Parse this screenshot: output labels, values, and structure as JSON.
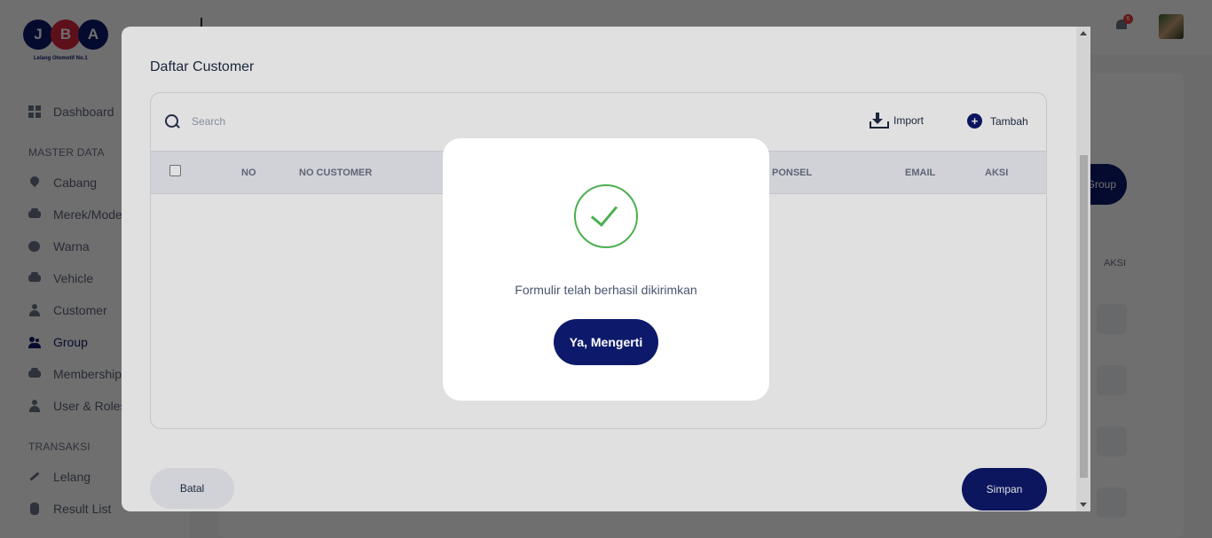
{
  "logo": {
    "letters": [
      "J",
      "B",
      "A"
    ],
    "tagline": "Lelang Otomotif No.1"
  },
  "sidebar": {
    "items": [
      {
        "label": "Dashboard",
        "icon": "grid-icon"
      },
      {
        "label": "Cabang",
        "icon": "location-pin-icon"
      },
      {
        "label": "Merek/Model",
        "icon": "car-icon"
      },
      {
        "label": "Warna",
        "icon": "palette-icon"
      },
      {
        "label": "Vehicle",
        "icon": "car-icon"
      },
      {
        "label": "Customer",
        "icon": "user-icon"
      },
      {
        "label": "Group",
        "icon": "group-icon"
      },
      {
        "label": "Membership",
        "icon": "car-icon"
      },
      {
        "label": "User & Roles",
        "icon": "user-roles-icon"
      },
      {
        "label": "Lelang",
        "icon": "gavel-icon"
      },
      {
        "label": "Result List",
        "icon": "database-icon"
      }
    ],
    "sections": {
      "master": "MASTER DATA",
      "transaksi": "TRANSAKSI"
    }
  },
  "header": {
    "notification_count": "6"
  },
  "background": {
    "group_button": "Group",
    "aksi_header": "AKSI"
  },
  "modal": {
    "title": "Daftar Customer",
    "search_placeholder": "Search",
    "import_label": "Import",
    "add_label": "Tambah",
    "columns": [
      "NO",
      "NO CUSTOMER",
      "PONSEL",
      "EMAIL",
      "AKSI"
    ],
    "cancel_label": "Batal",
    "save_label": "Simpan"
  },
  "dialog": {
    "message": "Formulir telah berhasil dikirimkan",
    "confirm_label": "Ya, Mengerti"
  },
  "colors": {
    "primary": "#0d1a6b",
    "success": "#4caf50",
    "danger": "#d7263d"
  }
}
